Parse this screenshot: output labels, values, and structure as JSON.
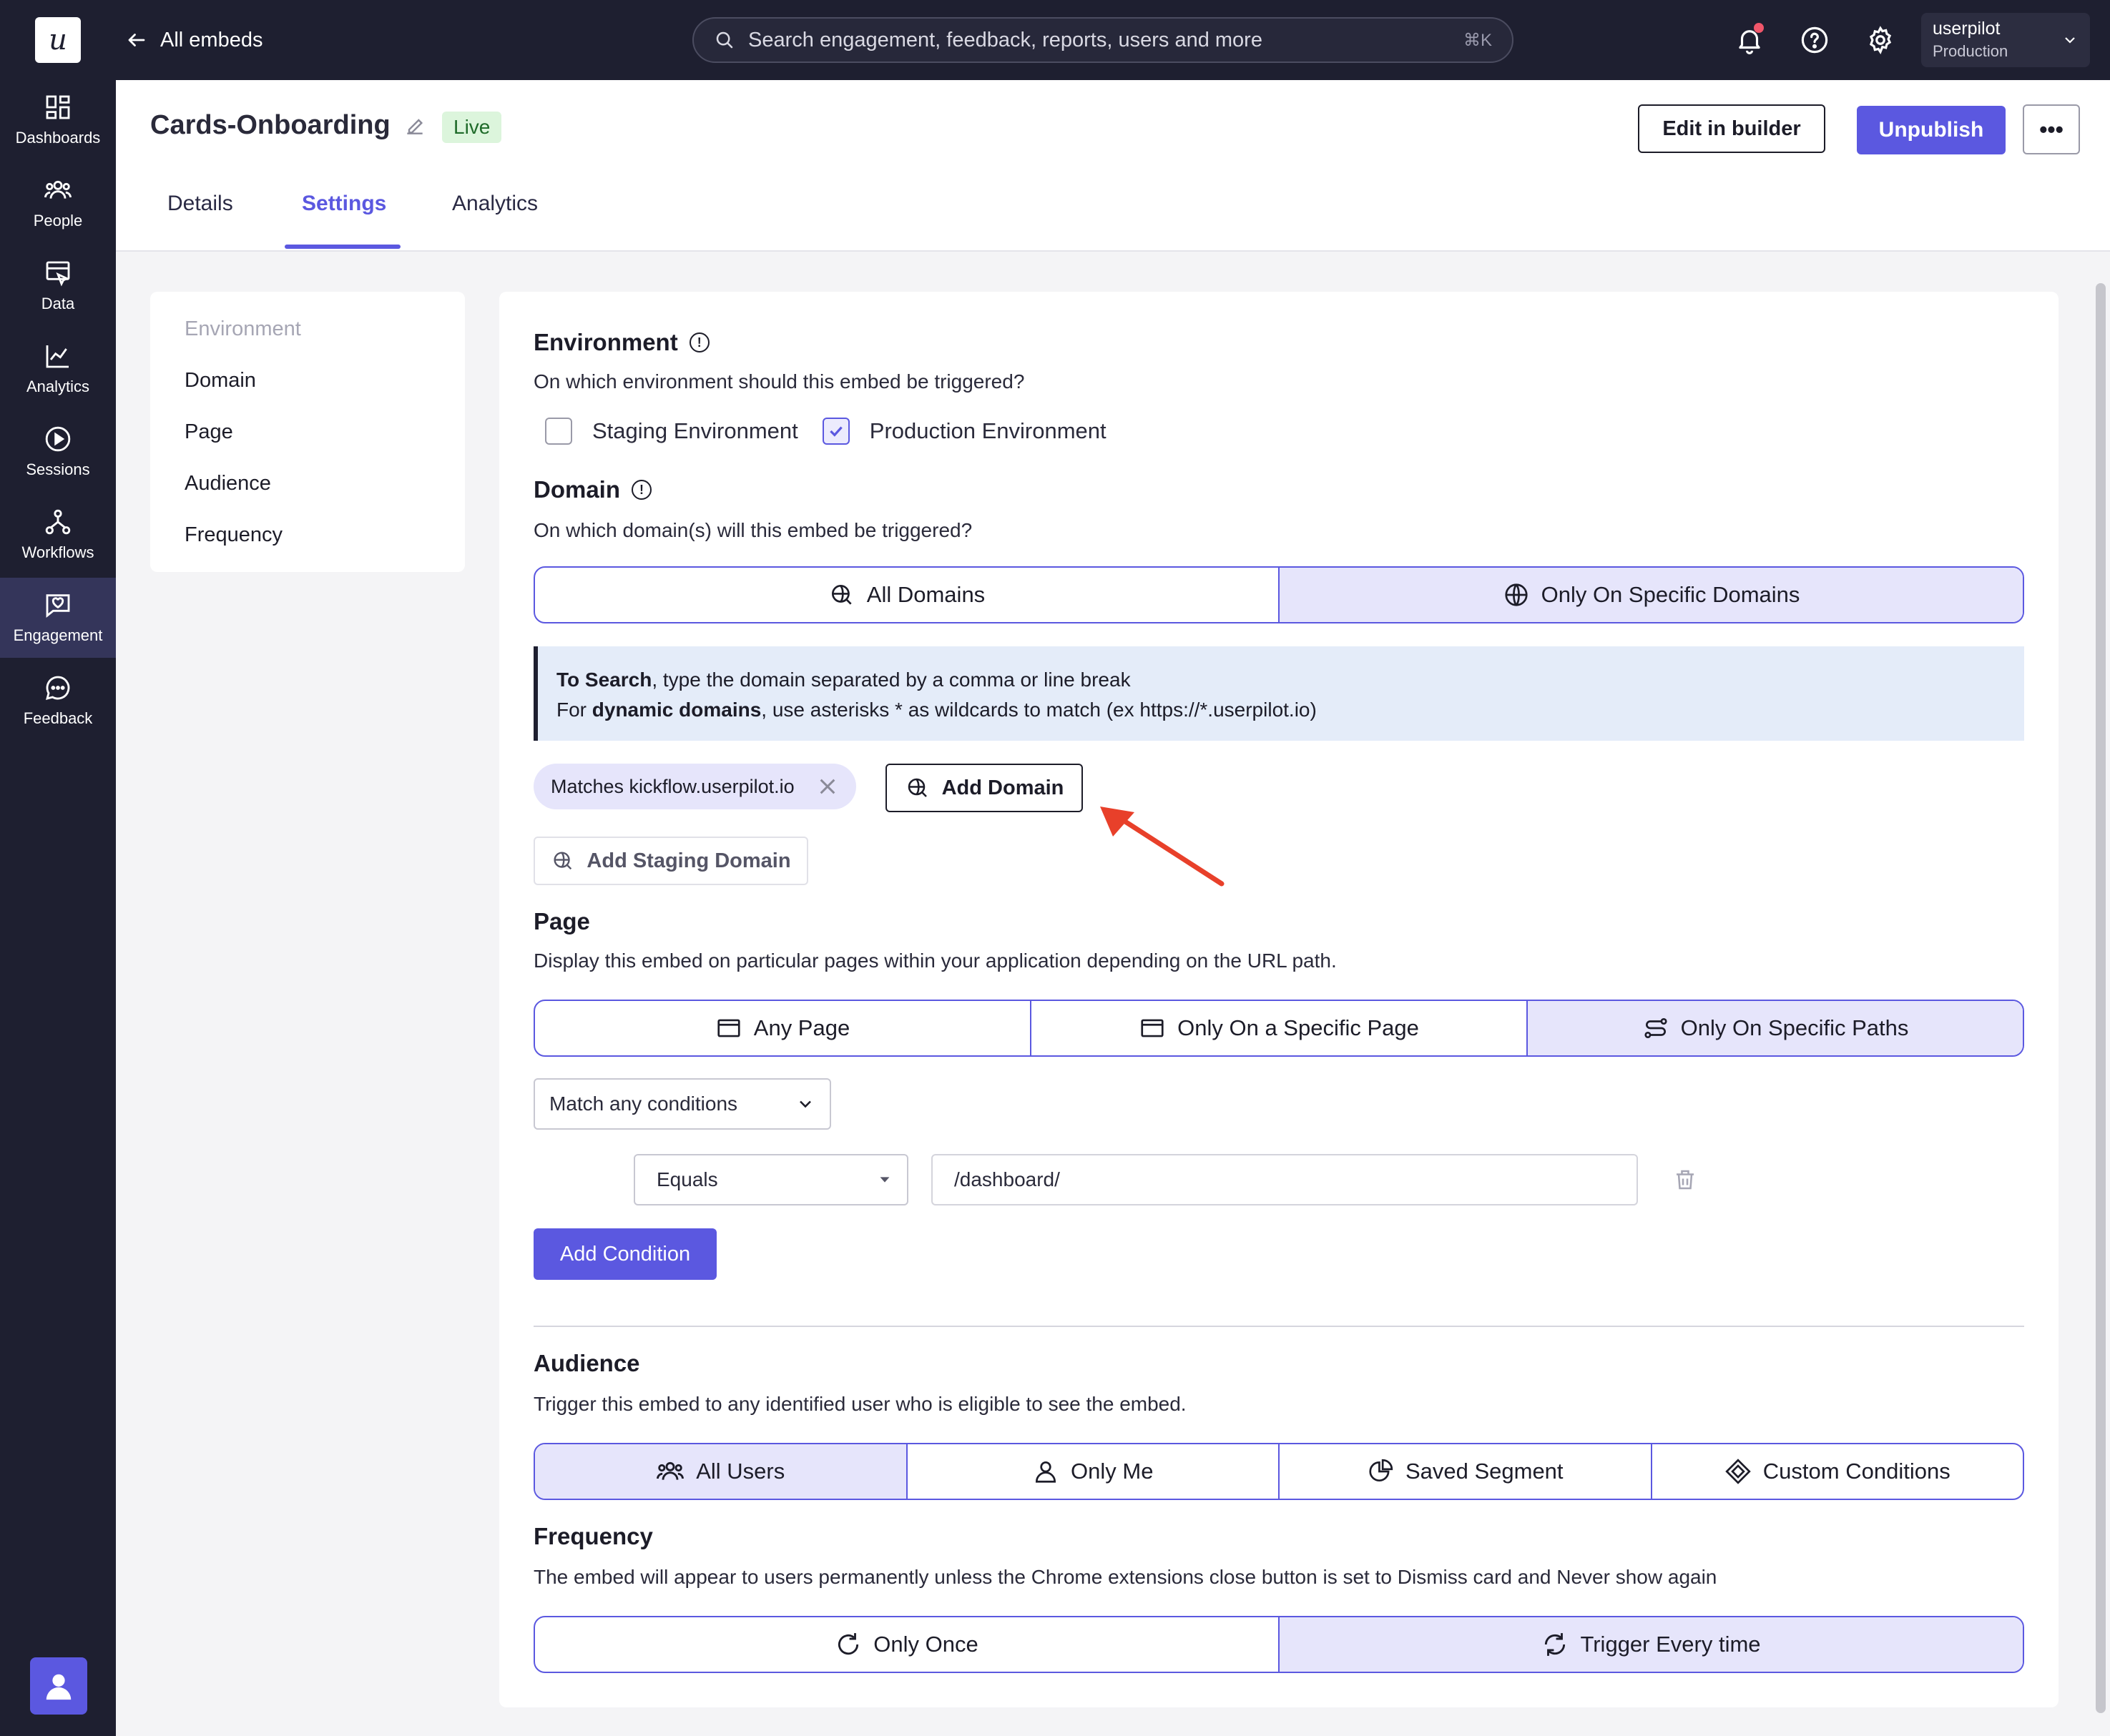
{
  "topbar": {
    "logo": "u",
    "back_label": "All embeds",
    "search_placeholder": "Search engagement, feedback, reports, users and more",
    "search_shortcut": "⌘K",
    "account_name": "userpilot",
    "account_env": "Production"
  },
  "nav": {
    "items": [
      {
        "label": "Dashboards",
        "icon": "dashboards-icon"
      },
      {
        "label": "People",
        "icon": "people-icon"
      },
      {
        "label": "Data",
        "icon": "data-icon"
      },
      {
        "label": "Analytics",
        "icon": "analytics-icon"
      },
      {
        "label": "Sessions",
        "icon": "sessions-icon"
      },
      {
        "label": "Workflows",
        "icon": "workflows-icon"
      },
      {
        "label": "Engagement",
        "icon": "engagement-icon",
        "active": true
      },
      {
        "label": "Feedback",
        "icon": "feedback-icon"
      }
    ]
  },
  "header": {
    "title": "Cards-Onboarding",
    "status": "Live",
    "edit_button": "Edit in builder",
    "unpublish_button": "Unpublish",
    "more_button": "•••",
    "tabs": [
      "Details",
      "Settings",
      "Analytics"
    ],
    "active_tab": "Settings"
  },
  "sidemenu": {
    "items": [
      "Environment",
      "Domain",
      "Page",
      "Audience",
      "Frequency"
    ]
  },
  "environment": {
    "title": "Environment",
    "question": "On which environment should this embed be triggered?",
    "staging_label": "Staging Environment",
    "staging_checked": false,
    "production_label": "Production Environment",
    "production_checked": true
  },
  "domain": {
    "title": "Domain",
    "question": "On which domain(s) will this embed be triggered?",
    "options": [
      "All Domains",
      "Only On Specific Domains"
    ],
    "selected": "Only On Specific Domains",
    "info_line1_bold": "To Search",
    "info_line1_rest": ", type the domain separated by a comma or line break",
    "info_line2_pre": "For ",
    "info_line2_bold": "dynamic domains",
    "info_line2_rest": ", use asterisks * as wildcards to match (ex https://*.userpilot.io)",
    "chip_label": "Matches kickflow.userpilot.io",
    "add_domain_button": "Add Domain",
    "add_staging_button": "Add Staging Domain"
  },
  "page": {
    "title": "Page",
    "description": "Display this embed on particular pages within your application depending on the URL path.",
    "options": [
      "Any Page",
      "Only On a Specific Page",
      "Only On Specific Paths"
    ],
    "selected": "Only On Specific Paths",
    "match_select": "Match any conditions",
    "operator_select": "Equals",
    "path_value": "/dashboard/",
    "add_condition_button": "Add Condition"
  },
  "audience": {
    "title": "Audience",
    "description": "Trigger this embed to any identified user who is eligible to see the embed.",
    "options": [
      "All Users",
      "Only Me",
      "Saved Segment",
      "Custom Conditions"
    ],
    "selected": "All Users"
  },
  "frequency": {
    "title": "Frequency",
    "description": "The embed will appear to users permanently unless the Chrome extensions close button is set to Dismiss card and Never show again",
    "options": [
      "Only Once",
      "Trigger Every time"
    ],
    "selected": "Trigger Every time"
  },
  "colors": {
    "primary": "#5b58e0",
    "nav_bg": "#1e1f30",
    "selected_bg": "#e6e5fb",
    "live_bg": "#dcf5dc",
    "annotation_arrow": "#e8402a"
  }
}
